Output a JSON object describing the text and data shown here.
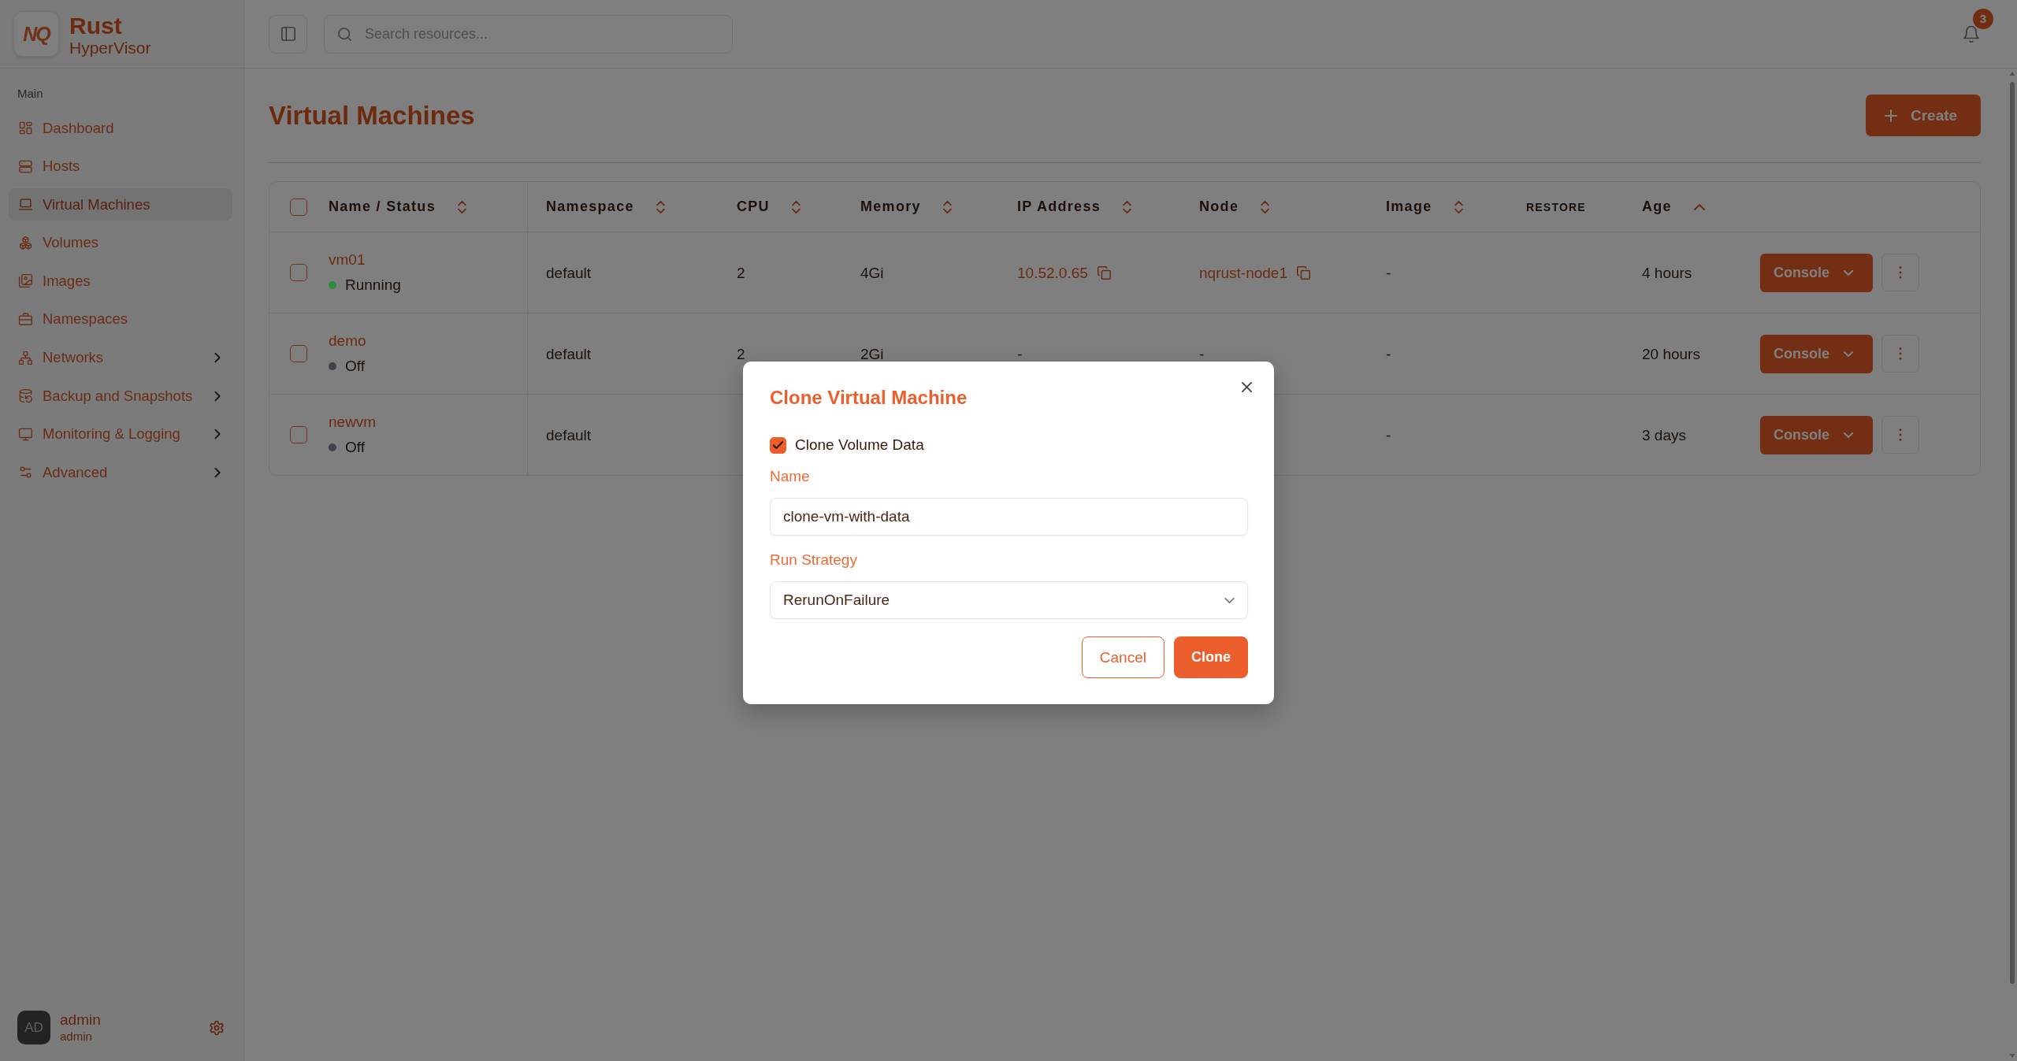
{
  "sidebar": {
    "brand": {
      "logo": "NQ",
      "name": "Rust",
      "subtitle": "HyperVisor"
    },
    "section": "Main",
    "items": [
      {
        "label": "Dashboard",
        "selected": false,
        "expandable": false
      },
      {
        "label": "Hosts",
        "selected": false,
        "expandable": false
      },
      {
        "label": "Virtual Machines",
        "selected": true,
        "expandable": false
      },
      {
        "label": "Volumes",
        "selected": false,
        "expandable": false
      },
      {
        "label": "Images",
        "selected": false,
        "expandable": false
      },
      {
        "label": "Namespaces",
        "selected": false,
        "expandable": false
      },
      {
        "label": "Networks",
        "selected": false,
        "expandable": true
      },
      {
        "label": "Backup and Snapshots",
        "selected": false,
        "expandable": true
      },
      {
        "label": "Monitoring & Logging",
        "selected": false,
        "expandable": true
      },
      {
        "label": "Advanced",
        "selected": false,
        "expandable": true
      }
    ],
    "user": {
      "avatar": "AD",
      "name": "admin",
      "role": "admin"
    }
  },
  "topbar": {
    "search": {
      "placeholder": "Search resources..."
    },
    "notifications": {
      "count": "3"
    }
  },
  "page": {
    "title": "Virtual Machines",
    "create_button": "Create"
  },
  "table": {
    "select_all": {
      "checked": false
    },
    "columns": [
      {
        "label": "Name / Status",
        "kind": "sortable",
        "sorted": false
      },
      {
        "label": "Namespace",
        "kind": "sortable",
        "sorted": false
      },
      {
        "label": "CPU",
        "kind": "sortable",
        "sorted": false
      },
      {
        "label": "Memory",
        "kind": "sortable",
        "sorted": false
      },
      {
        "label": "IP Address",
        "kind": "sortable",
        "sorted": false
      },
      {
        "label": "Node",
        "kind": "sortable",
        "sorted": false
      },
      {
        "label": "Image",
        "kind": "sortable",
        "sorted": false
      },
      {
        "label": "RESTORE",
        "kind": "plain"
      },
      {
        "label": "Age",
        "kind": "sortable",
        "sorted": true
      }
    ],
    "rows": [
      {
        "checked": false,
        "name": "vm01",
        "status": {
          "label": "Running",
          "color": "#2e8b3f"
        },
        "namespace": "default",
        "cpu": "2",
        "memory": "4Gi",
        "ip": {
          "text": "10.52.0.65",
          "copyable": true
        },
        "node": {
          "text": "nqrust-node1",
          "copyable": true
        },
        "image": "-",
        "age": "4 hours",
        "action": "Console"
      },
      {
        "checked": false,
        "name": "demo",
        "status": {
          "label": "Off",
          "color": "#3f434b"
        },
        "namespace": "default",
        "cpu": "2",
        "memory": "2Gi",
        "ip": {
          "text": "-",
          "copyable": false
        },
        "node": {
          "text": "-",
          "copyable": false
        },
        "image": "-",
        "age": "20 hours",
        "action": "Console"
      },
      {
        "checked": false,
        "name": "newvm",
        "status": {
          "label": "Off",
          "color": "#3f434b"
        },
        "namespace": "default",
        "image": "-",
        "age": "3 days",
        "action": "Console"
      }
    ]
  },
  "modal": {
    "title": "Clone Virtual Machine",
    "checkbox": {
      "label": "Clone Volume Data",
      "checked": true
    },
    "fields": [
      {
        "kind": "text",
        "label": "Name",
        "value": "clone-vm-with-data"
      },
      {
        "kind": "select",
        "label": "Run Strategy",
        "value": "RerunOnFailure"
      }
    ],
    "buttons": [
      {
        "label": "Cancel",
        "kind": "secondary"
      },
      {
        "label": "Clone",
        "kind": "primary"
      }
    ]
  }
}
